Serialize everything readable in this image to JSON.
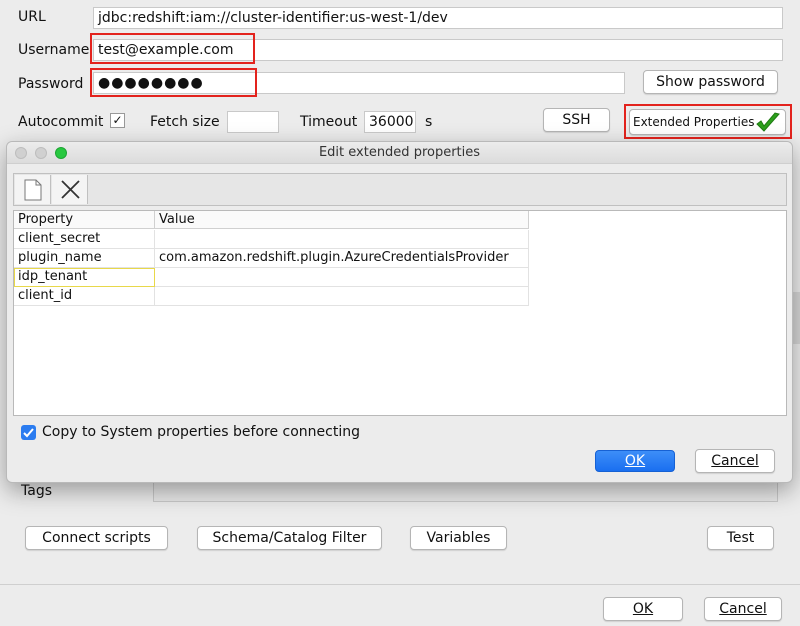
{
  "connection": {
    "url_label": "URL",
    "url_value": "jdbc:redshift:iam://cluster-identifier:us-west-1/dev",
    "username_label": "Username",
    "username_value": "test@example.com",
    "password_label": "Password",
    "password_value": "●●●●●●●●",
    "show_password_label": "Show password",
    "autocommit_label": "Autocommit",
    "autocommit_mark": "✓",
    "fetch_size_label": "Fetch size",
    "timeout_label": "Timeout",
    "timeout_value": "36000",
    "timeout_unit": "s",
    "ssh_label": "SSH",
    "extended_properties_label": "Extended Properties",
    "tags_label": "Tags"
  },
  "dialog": {
    "title": "Edit extended properties",
    "columns": [
      "Property",
      "Value"
    ],
    "rows": [
      {
        "property": "client_secret",
        "value": ""
      },
      {
        "property": "plugin_name",
        "value": "com.amazon.redshift.plugin.AzureCredentialsProvider"
      },
      {
        "property": "idp_tenant",
        "value": ""
      },
      {
        "property": "client_id",
        "value": ""
      }
    ],
    "copy_system_label": "Copy to System properties before connecting",
    "ok_label": "OK",
    "cancel_label": "Cancel"
  },
  "bottom_buttons": {
    "connect_scripts": "Connect scripts",
    "schema_filter": "Schema/Catalog Filter",
    "variables": "Variables",
    "test": "Test",
    "ok": "OK",
    "cancel": "Cancel"
  },
  "colors": {
    "annotation_red": "#e3231d",
    "check_green": "#2ca01c",
    "ok_blue": "#1a6ff0"
  }
}
